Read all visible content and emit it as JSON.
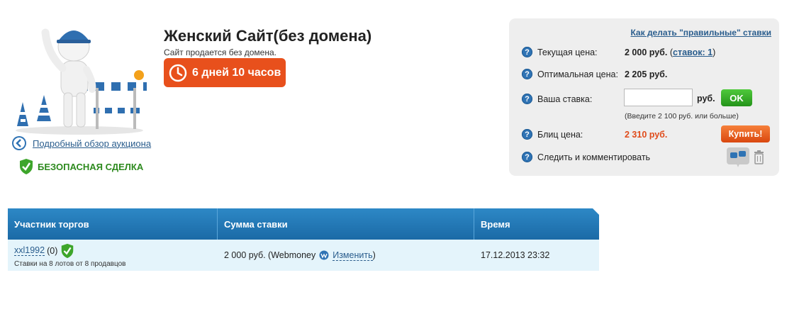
{
  "lot": {
    "title": "Женский Сайт(без домена)",
    "subtitle": "Сайт продается без домена.",
    "timer": "6 дней 10 часов"
  },
  "links": {
    "back": "Подробный обзор аукциона",
    "safe_deal": "БЕЗОПАСНАЯ СДЕЛКА"
  },
  "panel": {
    "howto_link": "Как делать \"правильные\" ставки",
    "current_price_label": "Текущая цена:",
    "current_price_value": "2 000 руб.",
    "bids_open": "(",
    "bids_link": "ставок: 1",
    "bids_close": ")",
    "optimal_price_label": "Оптимальная цена:",
    "optimal_price_value": "2 205 руб.",
    "your_bid_label": "Ваша ставка:",
    "your_bid_value": "",
    "currency": "руб.",
    "ok_button": "OK",
    "bid_hint": "(Введите 2 100 руб. или больше)",
    "blitz_label": "Блиц цена:",
    "blitz_value": "2 310 руб.",
    "buy_button": "Купить!",
    "watch_label": "Следить и комментировать"
  },
  "table": {
    "headers": [
      "Участник торгов",
      "Сумма ставки",
      "Время"
    ],
    "rows": [
      {
        "user": "xxl1992",
        "rating": "(0)",
        "stats": "Ставки на 8 лотов от 8 продавцов",
        "amount": "2 000 руб. (Webmoney",
        "change": "Изменить",
        "amount_close": ")",
        "time": "17.12.2013 23:32"
      }
    ]
  },
  "colors": {
    "timer_bg": "#e8501c",
    "link": "#2a5d8d",
    "safe_green": "#2d8a1e",
    "blitz_red": "#e04b1a",
    "table_header": "#1f74b2",
    "table_row": "#e4f4fb"
  },
  "icons": [
    "clock-icon",
    "back-arrow-icon",
    "shield-check-icon",
    "question-icon",
    "binoculars-icon",
    "trash-icon",
    "webmoney-icon",
    "construction-worker-illustration"
  ]
}
